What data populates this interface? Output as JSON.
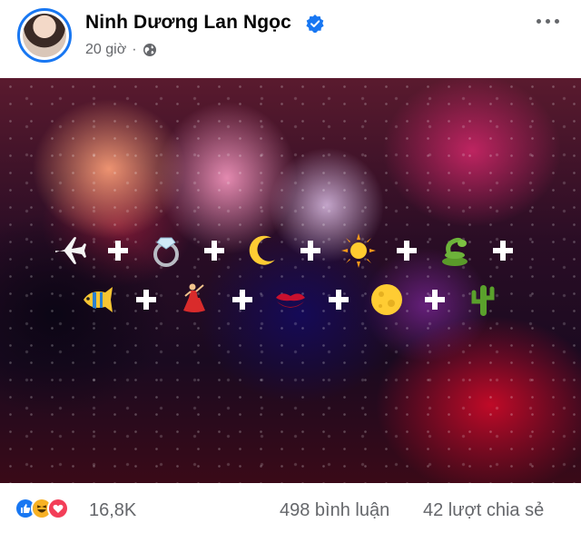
{
  "post": {
    "author": "Ninh Dương Lan Ngọc",
    "time": "20 giờ",
    "separator": "·",
    "verified": true,
    "privacy_icon": "globe-icon"
  },
  "image": {
    "row1": [
      "airplane",
      "ring",
      "crescent-moon",
      "sun",
      "snake"
    ],
    "row2": [
      "tropical-fish",
      "dancer",
      "kiss-mark",
      "full-moon",
      "cactus"
    ],
    "operator": "+"
  },
  "stats": {
    "reactions": [
      "like",
      "haha",
      "love"
    ],
    "reaction_count": "16,8K",
    "comments": "498 bình luận",
    "shares": "42 lượt chia sẻ"
  },
  "colors": {
    "accent": "#1877f2",
    "secondary_text": "#65676b",
    "love": "#f33e58",
    "haha": "#f7b125"
  }
}
